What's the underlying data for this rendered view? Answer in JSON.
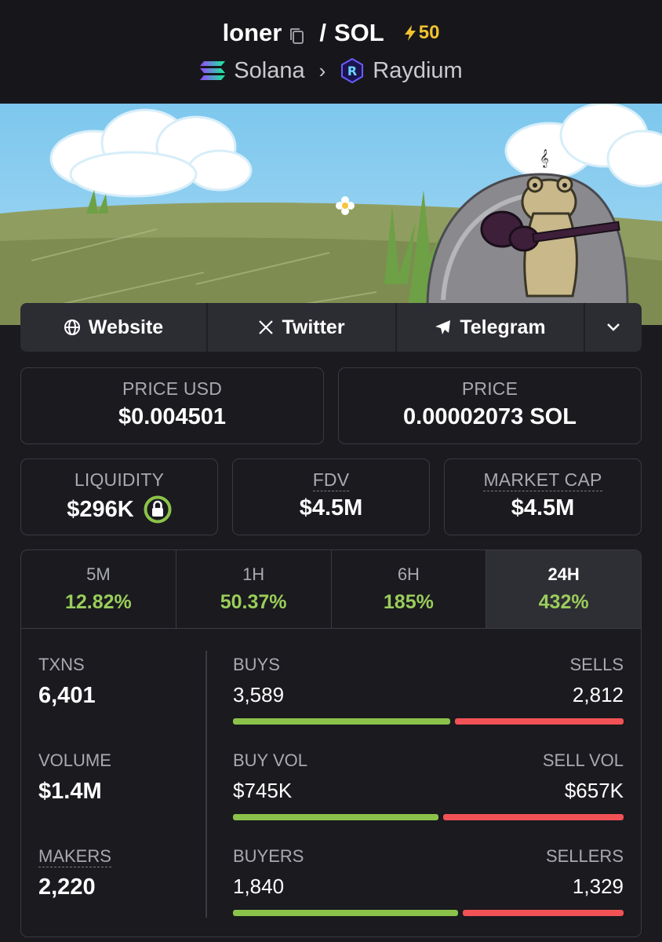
{
  "header": {
    "token": "loner",
    "separator": "/",
    "quote": "SOL",
    "boost": "50",
    "chain": "Solana",
    "dex": "Raydium",
    "icons": [
      "copy-icon",
      "bolt-icon",
      "solana-logo",
      "raydium-logo",
      "chevron-right-icon"
    ]
  },
  "links": {
    "website": "Website",
    "twitter": "Twitter",
    "telegram": "Telegram"
  },
  "prices": {
    "price_usd_label": "PRICE USD",
    "price_usd": "$0.004501",
    "price_label": "PRICE",
    "price": "0.00002073 SOL"
  },
  "metrics": {
    "liquidity_label": "LIQUIDITY",
    "liquidity": "$296K",
    "fdv_label": "FDV",
    "fdv": "$4.5M",
    "mcap_label": "MARKET CAP",
    "mcap": "$4.5M"
  },
  "timeframes": [
    {
      "label": "5M",
      "change": "12.82%"
    },
    {
      "label": "1H",
      "change": "50.37%"
    },
    {
      "label": "6H",
      "change": "185%"
    },
    {
      "label": "24H",
      "change": "432%",
      "active": true
    }
  ],
  "stats": {
    "txns_label": "TXNS",
    "txns": "6,401",
    "volume_label": "VOLUME",
    "volume": "$1.4M",
    "makers_label": "MAKERS",
    "makers": "2,220",
    "buys_label": "BUYS",
    "buys": "3,589",
    "sells_label": "SELLS",
    "sells": "2,812",
    "buy_vol_label": "BUY VOL",
    "buy_vol": "$745K",
    "sell_vol_label": "SELL VOL",
    "sell_vol": "$657K",
    "buyers_label": "BUYERS",
    "buyers": "1,840",
    "sellers_label": "SELLERS",
    "sellers": "1,329"
  },
  "colors": {
    "positive": "#9acd5a",
    "buy_bar": "#8bc34a",
    "sell_bar": "#f25256",
    "boost": "#f2c12e"
  }
}
